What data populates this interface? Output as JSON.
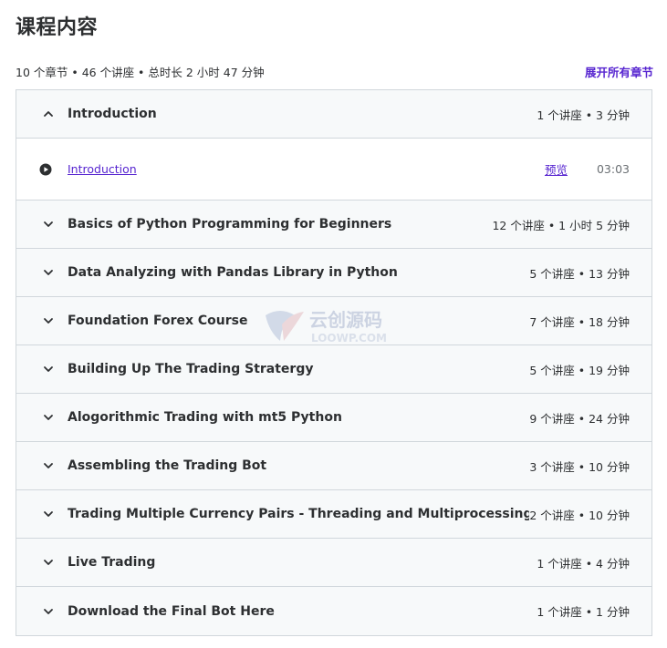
{
  "title": "课程内容",
  "summary": "10 个章节 • 46 个讲座 • 总时长 2 小时 47 分钟",
  "expand_all": "展开所有章节",
  "sections": [
    {
      "title": "Introduction",
      "meta": "1 个讲座 • 3 分钟",
      "expanded": true,
      "lectures": [
        {
          "title": "Introduction",
          "preview": "预览",
          "duration": "03:03"
        }
      ]
    },
    {
      "title": "Basics of Python Programming for Beginners",
      "meta": "12 个讲座 • 1 小时 5 分钟",
      "expanded": false
    },
    {
      "title": "Data Analyzing with Pandas Library in Python",
      "meta": "5 个讲座 • 13 分钟",
      "expanded": false
    },
    {
      "title": "Foundation Forex Course",
      "meta": "7 个讲座 • 18 分钟",
      "expanded": false
    },
    {
      "title": "Building Up The Trading Stratergy",
      "meta": "5 个讲座 • 19 分钟",
      "expanded": false
    },
    {
      "title": "Alogorithmic Trading with mt5 Python",
      "meta": "9 个讲座 • 24 分钟",
      "expanded": false
    },
    {
      "title": "Assembling the Trading Bot",
      "meta": "3 个讲座 • 10 分钟",
      "expanded": false
    },
    {
      "title": "Trading Multiple Currency Pairs - Threading and Multiprocessing",
      "meta": "2 个讲座 • 10 分钟",
      "expanded": false
    },
    {
      "title": "Live Trading",
      "meta": "1 个讲座 • 4 分钟",
      "expanded": false
    },
    {
      "title": "Download the Final Bot Here",
      "meta": "1 个讲座 • 1 分钟",
      "expanded": false
    }
  ],
  "watermark": {
    "line1": "云创源码",
    "line2": "LOOWP.COM"
  },
  "colors": {
    "accent": "#5624d0",
    "text": "#2d2f31",
    "muted": "#6a6f73",
    "border": "#d1d7dc",
    "header_bg": "#f7f9fa"
  }
}
